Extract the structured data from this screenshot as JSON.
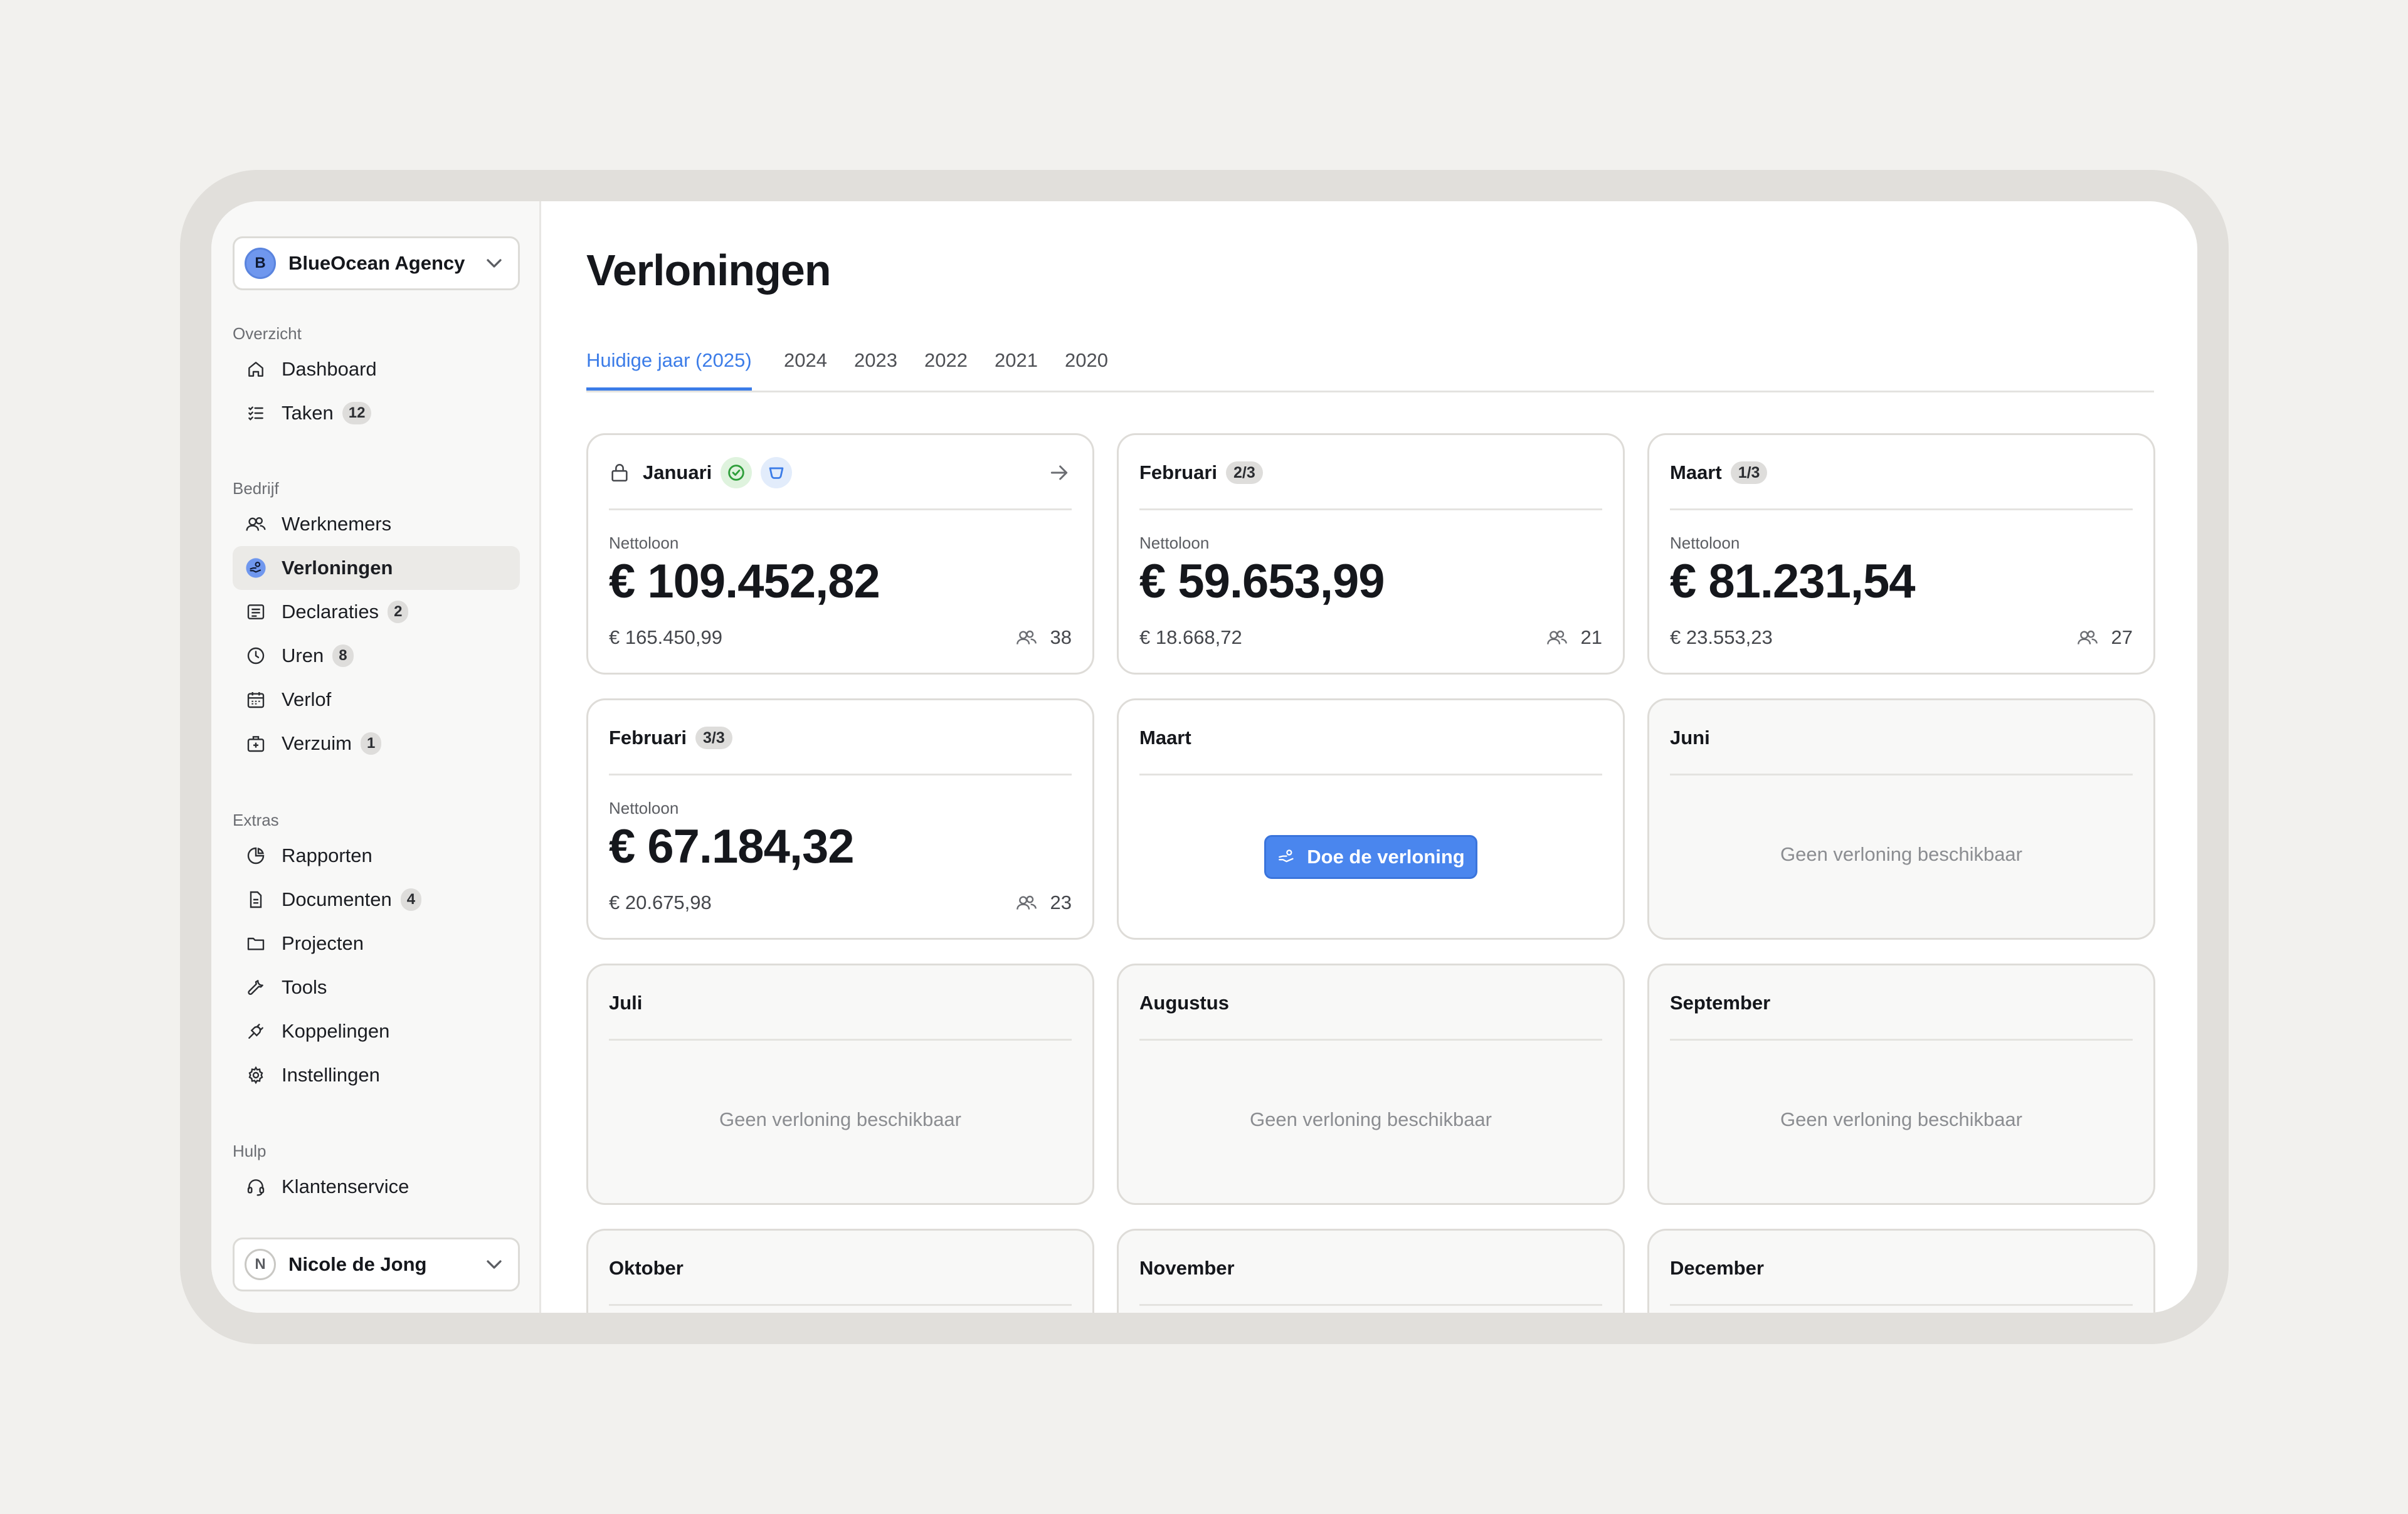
{
  "sidebar": {
    "workspace": {
      "initial": "B",
      "name": "BlueOcean Agency"
    },
    "sections": [
      {
        "label": "Overzicht"
      },
      {
        "label": "Bedrijf"
      },
      {
        "label": "Extras"
      },
      {
        "label": "Hulp"
      }
    ],
    "items": [
      {
        "label": "Dashboard",
        "icon": "home-icon"
      },
      {
        "label": "Taken",
        "badge": "12",
        "icon": "task-list-icon"
      },
      {
        "label": "Werknemers",
        "icon": "users-icon"
      },
      {
        "label": "Verloningen",
        "icon": "payroll-hand-icon",
        "active": true
      },
      {
        "label": "Declaraties",
        "badge": "2",
        "icon": "receipt-icon"
      },
      {
        "label": "Uren",
        "badge": "8",
        "icon": "clock-icon"
      },
      {
        "label": "Verlof",
        "icon": "calendar-icon"
      },
      {
        "label": "Verzuim",
        "badge": "1",
        "icon": "medical-bag-icon"
      },
      {
        "label": "Rapporten",
        "icon": "pie-chart-icon"
      },
      {
        "label": "Documenten",
        "badge": "4",
        "icon": "document-icon"
      },
      {
        "label": "Projecten",
        "icon": "folder-icon"
      },
      {
        "label": "Tools",
        "icon": "wrench-icon"
      },
      {
        "label": "Koppelingen",
        "icon": "plug-icon"
      },
      {
        "label": "Instellingen",
        "icon": "gear-icon"
      },
      {
        "label": "Klantenservice",
        "icon": "headset-icon"
      }
    ],
    "user": {
      "initial": "N",
      "name": "Nicole de Jong"
    }
  },
  "main": {
    "title": "Verloningen",
    "tabs": [
      {
        "label": "Huidige jaar (2025)",
        "active": true
      },
      {
        "label": "2024"
      },
      {
        "label": "2023"
      },
      {
        "label": "2022"
      },
      {
        "label": "2021"
      },
      {
        "label": "2020"
      }
    ],
    "net_label": "Nettoloon",
    "empty_text": "Geen verloning beschikbaar",
    "cta_label": "Doe de verloning",
    "cards": [
      {
        "month": "Januari",
        "net": "€ 109.452,82",
        "gross": "€ 165.450,99",
        "employees": "38"
      },
      {
        "month": "Februari",
        "badge": "2/3",
        "net": "€ 59.653,99",
        "gross": "€ 18.668,72",
        "employees": "21"
      },
      {
        "month": "Maart",
        "badge": "1/3",
        "net": "€ 81.231,54",
        "gross": "€ 23.553,23",
        "employees": "27"
      },
      {
        "month": "Februari",
        "badge": "3/3",
        "net": "€ 67.184,32",
        "gross": "€ 20.675,98",
        "employees": "23"
      },
      {
        "month": "Maart"
      },
      {
        "month": "Juni"
      },
      {
        "month": "Juli"
      },
      {
        "month": "Augustus"
      },
      {
        "month": "September"
      },
      {
        "month": "Oktober"
      },
      {
        "month": "November"
      },
      {
        "month": "December"
      }
    ]
  },
  "colors": {
    "accent": "#3b7ce8",
    "success_bg": "#dff3de",
    "page_bg": "#f2f1ee"
  }
}
